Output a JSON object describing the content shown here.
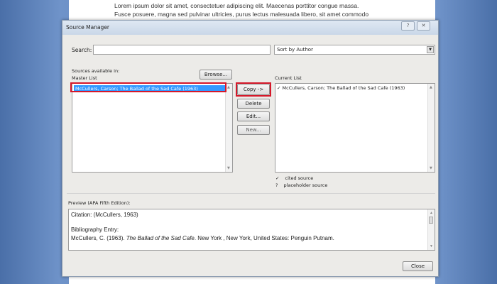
{
  "document": {
    "lines": [
      "Lorem ipsum dolor sit amet, consectetuer adipiscing elit. Maecenas porttitor congue massa.",
      "Fusce posuere, magna sed pulvinar ultricies, purus lectus malesuada libero, sit amet commodo"
    ]
  },
  "dialog": {
    "title": "Source Manager",
    "help_icon": "?",
    "close_icon": "✕",
    "search_label": "Search:",
    "search_value": "",
    "sort_value": "Sort by Author",
    "sources_available_label": "Sources available in:",
    "master_list_label": "Master List",
    "browse_label": "Browse...",
    "master_list_items": [
      "McCullers, Carson; The Ballad of the Sad Cafe (1963)"
    ],
    "current_list_label": "Current List",
    "current_list_items": [
      {
        "mark": "✓",
        "text": "McCullers, Carson; The Ballad of the Sad Cafe (1963)"
      }
    ],
    "copy_label": "Copy ->",
    "delete_label": "Delete",
    "edit_label": "Edit...",
    "new_label": "New...",
    "legend": [
      {
        "mark": "✓",
        "text": "cited source"
      },
      {
        "mark": "?",
        "text": "placeholder source"
      }
    ],
    "preview_label": "Preview (APA Fifth Edition):",
    "preview": {
      "citation": "Citation: (McCullers, 1963)",
      "bib_heading": "Bibliography Entry:",
      "bib_author": "McCullers, C. (1963). ",
      "bib_title": "The Ballad of the Sad Cafe",
      "bib_rest": ". New York , New York, United States: Penguin Putnam."
    },
    "close_label": "Close"
  },
  "colors": {
    "highlight": "#3399ff",
    "annotation": "#d5182a"
  }
}
